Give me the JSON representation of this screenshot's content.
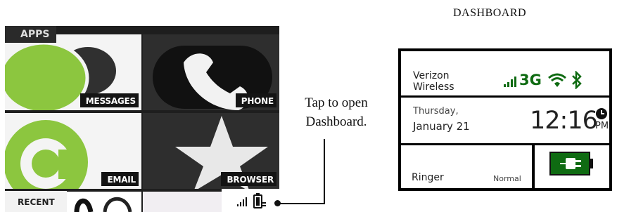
{
  "phone": {
    "apps_tag": "APPS",
    "recent_tag": "RECENT",
    "tiles": [
      {
        "label": "MESSAGES"
      },
      {
        "label": "PHONE"
      },
      {
        "label": "EMAIL"
      },
      {
        "label": "BROWSER"
      }
    ],
    "status_icons": [
      "signal-icon",
      "battery-icon"
    ]
  },
  "callout": {
    "text_line1": "Tap to open",
    "text_line2": "Dashboard."
  },
  "dashboard": {
    "heading": "DASHBOARD",
    "carrier_line1": "Verizon",
    "carrier_line2": "Wireless",
    "network_type": "3G",
    "day": "Thursday,",
    "date": "January 21",
    "time": "12:16",
    "ampm": "PM",
    "ringer_label": "Ringer",
    "ringer_state": "Normal"
  },
  "colors": {
    "accent_green": "#8cc63f",
    "status_green": "#0f6b12",
    "panel_black": "#000000"
  }
}
